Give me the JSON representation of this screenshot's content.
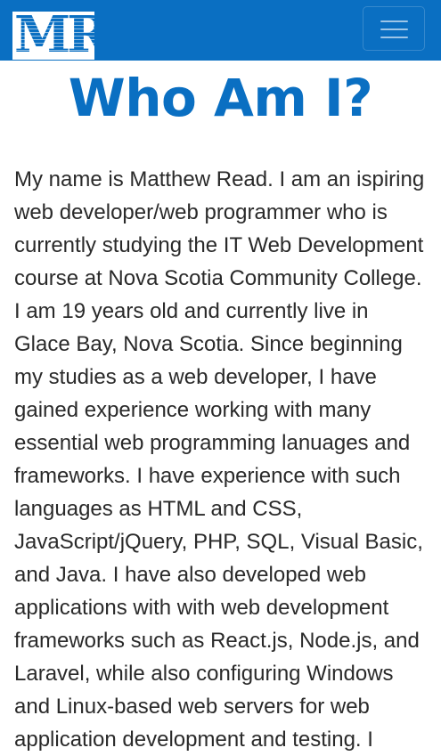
{
  "navbar": {
    "logo_text": "MR",
    "menu_icon": "hamburger-menu-icon",
    "color": "#0a6fc2"
  },
  "main": {
    "title": "Who Am I?",
    "bio": "My name is Matthew Read. I am an ispiring web developer/web programmer who is currently studying the IT Web Development course at Nova Scotia Community College. I am 19 years old and currently live in Glace Bay, Nova Scotia. Since beginning my studies as a web developer, I have gained experience working with many essential web programming lanuages and frameworks. I have experience with such languages as HTML and CSS, JavaScript/jQuery, PHP, SQL, Visual Basic, and Java. I have also developed web applications with with web development frameworks such as React.js, Node.js, and Laravel, while also configuring Windows and Linux-based web servers for web application development and testing. I"
  }
}
